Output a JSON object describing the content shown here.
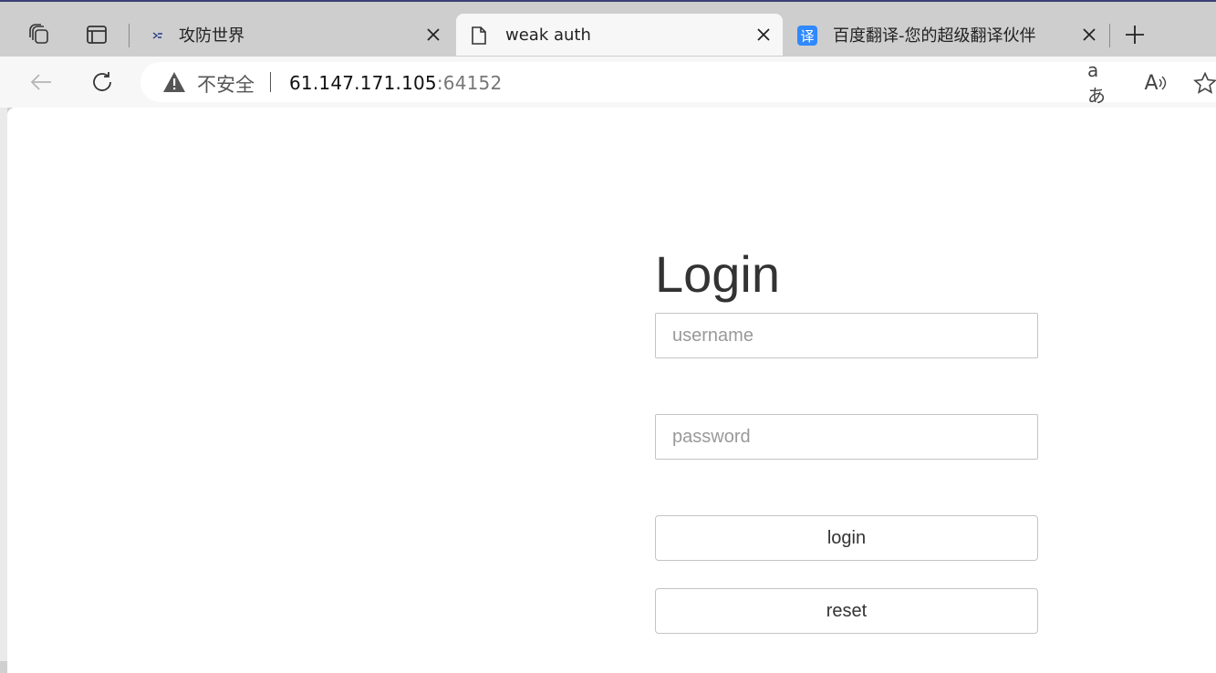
{
  "tabs": [
    {
      "title": "攻防世界",
      "favicon": "xctf-logo-icon",
      "active": false
    },
    {
      "title": "weak auth",
      "favicon": "page-icon",
      "active": true
    },
    {
      "title": "百度翻译-您的超级翻译伙伴",
      "favicon": "translate-icon",
      "favicon_text": "译",
      "active": false
    }
  ],
  "toolbar": {
    "security_label": "不安全",
    "url_host": "61.147.171.105",
    "url_port": ":64152",
    "translate_icon_text": "aあ",
    "read_aloud_icon_text": "A"
  },
  "login": {
    "title": "Login",
    "username_placeholder": "username",
    "password_placeholder": "password",
    "login_button": "login",
    "reset_button": "reset"
  },
  "colors": {
    "tab_strip": "#cecece",
    "toolbar": "#f7f7f7",
    "translate_favicon_bg": "#2f89fc"
  }
}
